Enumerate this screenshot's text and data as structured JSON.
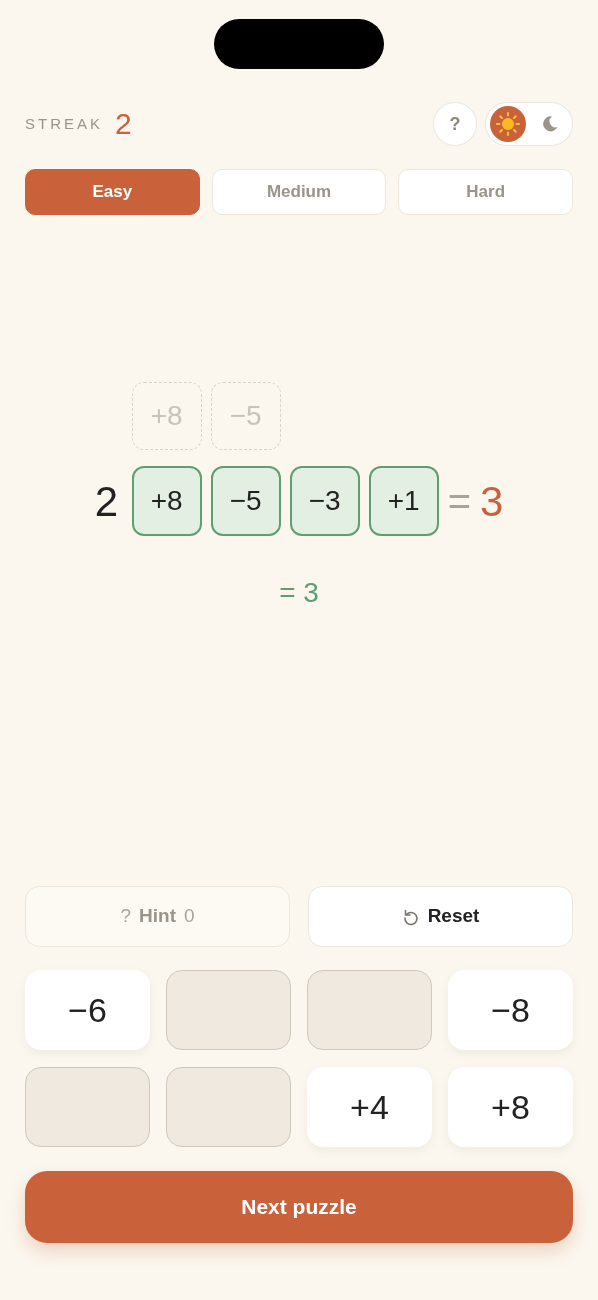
{
  "streak": {
    "label": "STREAK",
    "value": "2"
  },
  "help_button": {
    "label": "?"
  },
  "theme_toggle": [
    {
      "kind": "sun",
      "selected": true
    },
    {
      "kind": "moon",
      "selected": false
    }
  ],
  "difficulty_tabs": [
    {
      "label": "Easy",
      "selected": true
    },
    {
      "label": "Medium",
      "selected": false
    },
    {
      "label": "Hard",
      "selected": false
    }
  ],
  "puzzle": {
    "hint_tiles": [
      {
        "label": "+8"
      },
      {
        "label": "−5"
      }
    ],
    "start": "2",
    "tiles": [
      {
        "label": "+8"
      },
      {
        "label": "−5"
      },
      {
        "label": "−3"
      },
      {
        "label": "+1"
      }
    ],
    "equals": "=",
    "target": "3",
    "result": "= 3"
  },
  "hint_button": {
    "icon": "?",
    "label": "Hint",
    "count": "0",
    "disabled": true
  },
  "reset_button": {
    "label": "Reset"
  },
  "keypad": [
    {
      "label": "−6",
      "used": false
    },
    {
      "used": true
    },
    {
      "used": true
    },
    {
      "label": "−8",
      "used": false
    },
    {
      "used": true
    },
    {
      "used": true
    },
    {
      "label": "+4",
      "used": false
    },
    {
      "label": "+8",
      "used": false
    }
  ],
  "next_button": {
    "label": "Next puzzle"
  }
}
